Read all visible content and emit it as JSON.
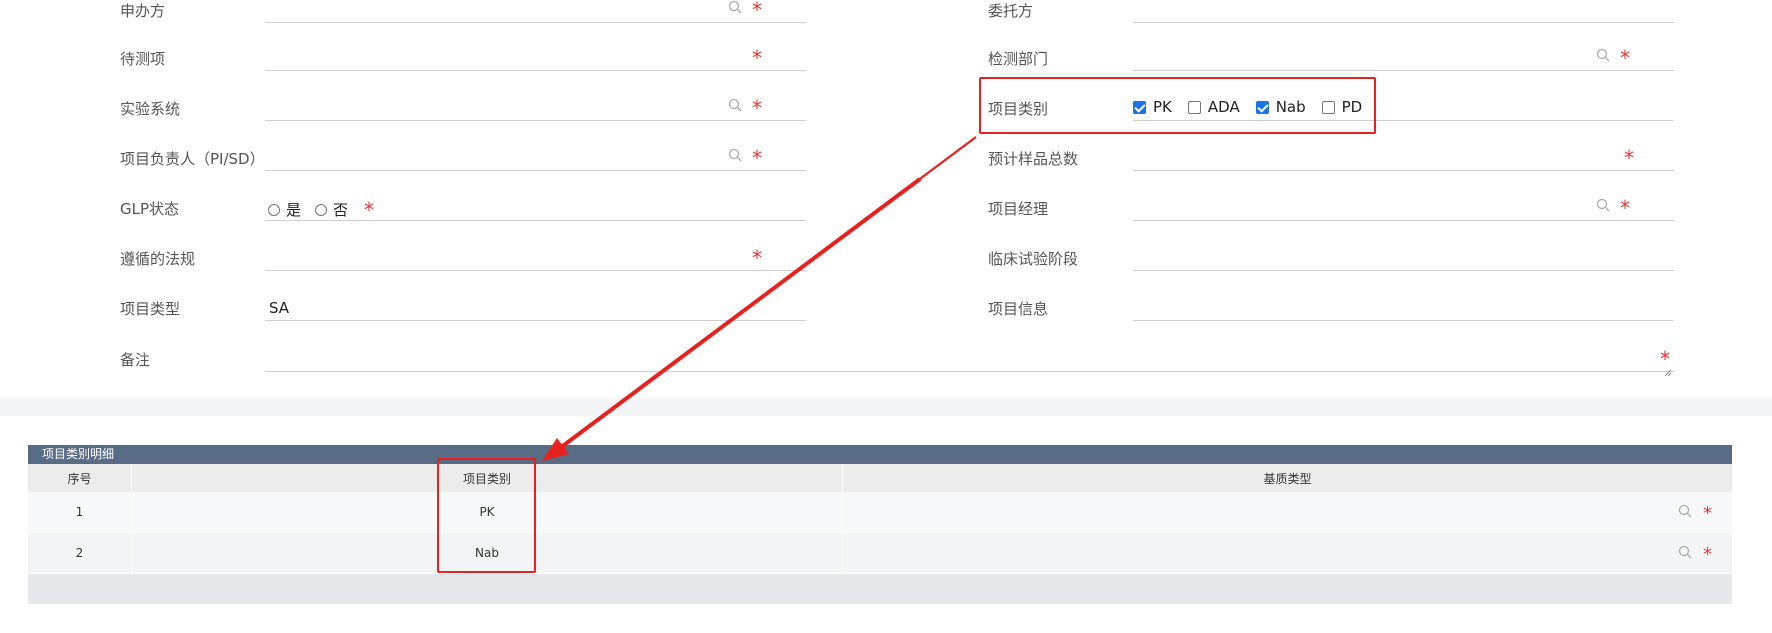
{
  "form": {
    "left": [
      {
        "label": "申办方",
        "value": "",
        "search": true,
        "required": true
      },
      {
        "label": "待测项",
        "value": "",
        "search": false,
        "required": true
      },
      {
        "label": "实验系统",
        "value": "",
        "search": true,
        "required": true
      },
      {
        "label": "项目负责人（PI/SD）",
        "value": "",
        "search": true,
        "required": true
      },
      {
        "label": "GLP状态",
        "radio": [
          "是",
          "否"
        ],
        "required": true
      },
      {
        "label": "遵循的法规",
        "value": "",
        "search": false,
        "required": true
      },
      {
        "label": "项目类型",
        "value": "SA",
        "search": false,
        "required": false
      }
    ],
    "right": [
      {
        "label": "委托方",
        "value": "",
        "search": false,
        "required": false
      },
      {
        "label": "检测部门",
        "value": "",
        "search": true,
        "required": true
      },
      {
        "label": "项目类别",
        "checkboxes": [
          {
            "label": "PK",
            "checked": true
          },
          {
            "label": "ADA",
            "checked": false
          },
          {
            "label": "Nab",
            "checked": true
          },
          {
            "label": "PD",
            "checked": false
          }
        ]
      },
      {
        "label": "预计样品总数",
        "value": "",
        "search": false,
        "required": true
      },
      {
        "label": "项目经理",
        "value": "",
        "search": true,
        "required": true
      },
      {
        "label": "临床试验阶段",
        "value": "",
        "search": false,
        "required": false
      },
      {
        "label": "项目信息",
        "value": "",
        "search": false,
        "required": false
      }
    ],
    "notes_label": "备注",
    "required_mark": "*"
  },
  "detail": {
    "title": "项目类别明细",
    "columns": [
      "序号",
      "项目类别",
      "基质类型"
    ],
    "rows": [
      {
        "index": "1",
        "category": "PK",
        "matrix": ""
      },
      {
        "index": "2",
        "category": "Nab",
        "matrix": ""
      }
    ]
  },
  "colors": {
    "required": "#e33333",
    "highlight": "#e8201e",
    "checkbox": "#1a73e8",
    "panel_header": "#5a6b85"
  }
}
